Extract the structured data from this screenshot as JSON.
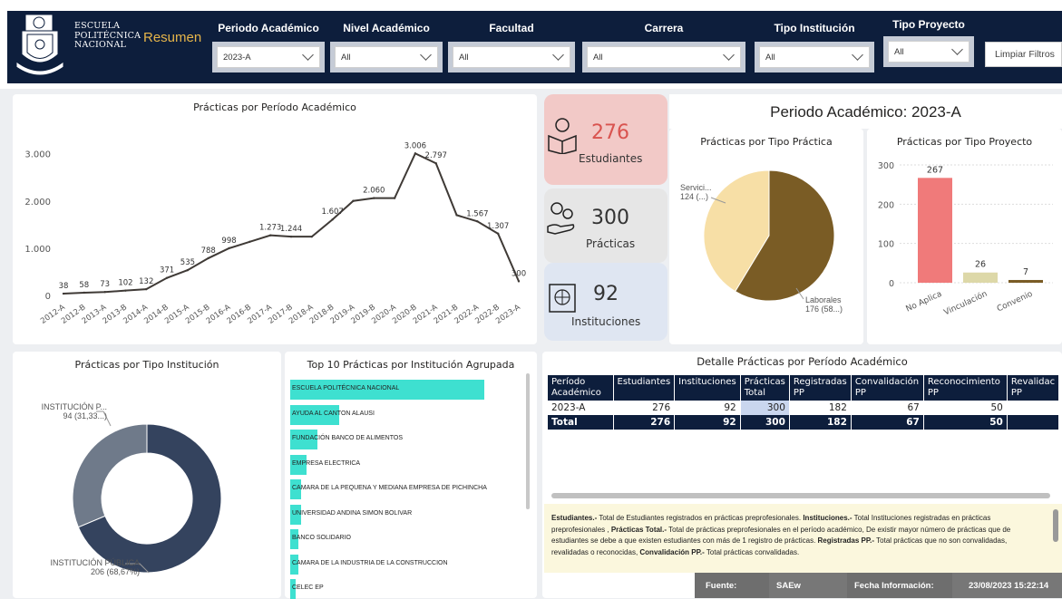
{
  "header": {
    "brand_line1": "ESCUELA",
    "brand_line2": "POLITÉCNICA",
    "brand_line3": "NACIONAL",
    "page_title": "Resumen",
    "clear_filters": "Limpiar Filtros",
    "filters": [
      {
        "label": "Periodo Académico",
        "value": "2023-A"
      },
      {
        "label": "Nivel Académico",
        "value": "All"
      },
      {
        "label": "Facultad",
        "value": "All"
      },
      {
        "label": "Carrera",
        "value": "All"
      },
      {
        "label": "Tipo Institución",
        "value": "All"
      },
      {
        "label": "Tipo Proyecto",
        "value": "All"
      }
    ]
  },
  "colors": {
    "navy": "#0d1e3c",
    "filter_bg": "#c5cbd6",
    "accent_gold": "#e6b54a",
    "line": "#3f3a36",
    "teal": "#3ee0d0",
    "salmon": "#f07a7a",
    "khaki": "#ddd8a8",
    "brown": "#7a5c25",
    "cream": "#f7dfa6",
    "donut_dark": "#34435e",
    "donut_light": "#6f7a8a"
  },
  "line_panel": {
    "title": "Prácticas por Período Académico"
  },
  "kpis": {
    "students": {
      "value": "276",
      "label": "Estudiantes",
      "icon": "student-reading-icon"
    },
    "practices": {
      "value": "300",
      "label": "Prácticas",
      "icon": "gears-hand-icon"
    },
    "institutions": {
      "value": "92",
      "label": "Instituciones",
      "icon": "building-globe-icon"
    }
  },
  "period_title": "Periodo Académico: 2023-A",
  "pie_panel": {
    "title": "Prácticas por Tipo Práctica",
    "label_a1": "Servici...",
    "label_a2": "124 (...)",
    "label_b1": "Laborales",
    "label_b2": "176 (58...)"
  },
  "proj_panel": {
    "title": "Prácticas por Tipo Proyecto"
  },
  "donut_panel": {
    "title": "Prácticas por Tipo Institución",
    "label_a1": "INSTITUCIÓN P...",
    "label_a2": "94 (31,33...)",
    "label_b1": "INSTITUCIÓN PÚBLICA",
    "label_b2": "206 (68,67%)"
  },
  "top10_panel": {
    "title": "Top 10 Prácticas por Institución Agrupada"
  },
  "detail_panel": {
    "title": "Detalle Prácticas por Período Académico",
    "headers": [
      "Período Académico",
      "Estudiantes",
      "Instituciones",
      "Prácticas Total",
      "Registradas PP",
      "Convalidación PP",
      "Reconocimiento PP",
      "Revalidac PP"
    ],
    "rows": [
      [
        "2023-A",
        "276",
        "92",
        "300",
        "182",
        "67",
        "50",
        ""
      ]
    ],
    "total": [
      "Total",
      "276",
      "92",
      "300",
      "182",
      "67",
      "50",
      ""
    ]
  },
  "note": {
    "t1": "Estudiantes.-",
    "d1": " Total de Estudiantes registrados en prácticas preprofesionales. ",
    "t2": "Instituciones.-",
    "d2": " Total Instituciones registradas en prácticas preprofesionales , ",
    "t3": "Prácticas Total.-",
    "d3": " Total de prácticas preprofesionales en el período académico, De existir mayor número de prácticas que de estudiantes se debe a que existen estudiantes con más de 1 registro de prácticas. ",
    "t4": "Registradas PP.-",
    "d4": " Total prácticas que no son convalidadas, revalidadas o reconocidas, ",
    "t5": "Convalidación PP.-",
    "d5": " Total prácticas convalidadas."
  },
  "footer": {
    "source_label": "Fuente:",
    "source_value": "SAEw",
    "date_label": "Fecha Información:",
    "date_value": "23/08/2023 15:22:14"
  },
  "chart_data": [
    {
      "type": "line",
      "title": "Prácticas por Período Académico",
      "x": [
        "2012-A",
        "2012-B",
        "2013-A",
        "2013-B",
        "2014-A",
        "2014-B",
        "2015-A",
        "2015-B",
        "2016-A",
        "2016-B",
        "2017-A",
        "2017-B",
        "2018-A",
        "2018-B",
        "2019-A",
        "2019-B",
        "2020-A",
        "2020-B",
        "2021-A",
        "2021-B",
        "2022-A",
        "2022-B",
        "2023-A"
      ],
      "values": [
        38,
        58,
        73,
        102,
        132,
        371,
        535,
        788,
        998,
        1136,
        1273,
        1244,
        1244,
        1607,
        2000,
        2060,
        2060,
        3006,
        2797,
        1700,
        1567,
        1307,
        300
      ],
      "labels": [
        "38",
        "58",
        "73",
        "102",
        "132",
        "371",
        "535",
        "788",
        "998",
        "",
        "1.273",
        "1.244",
        "",
        "1.607",
        "",
        "2.060",
        "",
        "3.006",
        "2.797",
        "",
        "1.567",
        "1.307",
        "300"
      ],
      "yticks": [
        "0",
        "1.000",
        "2.000",
        "3.000"
      ],
      "ylim": [
        0,
        3300
      ]
    },
    {
      "type": "pie",
      "title": "Prácticas por Tipo Práctica",
      "categories": [
        "Servicio",
        "Laborales"
      ],
      "values": [
        124,
        176
      ]
    },
    {
      "type": "bar",
      "title": "Prácticas por Tipo Proyecto",
      "categories": [
        "No Aplica",
        "Vinculación",
        "Convenio"
      ],
      "values": [
        267,
        26,
        7
      ],
      "yticks": [
        "0",
        "100",
        "200",
        "300"
      ],
      "ylim": [
        0,
        300
      ]
    },
    {
      "type": "pie",
      "title": "Prácticas por Tipo Institución",
      "categories": [
        "INSTITUCIÓN PRIVADA",
        "INSTITUCIÓN PÚBLICA"
      ],
      "values": [
        94,
        206
      ]
    },
    {
      "type": "bar",
      "title": "Top 10 Prácticas por Institución Agrupada",
      "categories": [
        "ESCUELA POLITÉCNICA NACIONAL",
        "AYUDA AL CANTON ALAUSI",
        "FUNDACIÓN BANCO DE ALIMENTOS",
        "EMPRESA ELECTRICA",
        "CAMARA DE LA PEQUENA Y MEDIANA EMPRESA DE PICHINCHA",
        "UNIVERSIDAD ANDINA SIMON BOLIVAR",
        "BANCO SOLIDARIO",
        "CAMARA DE LA INDUSTRIA DE LA CONSTRUCCION",
        "CELEC EP"
      ],
      "values": [
        71,
        18,
        10,
        6,
        4,
        4,
        3,
        3,
        2
      ]
    }
  ]
}
